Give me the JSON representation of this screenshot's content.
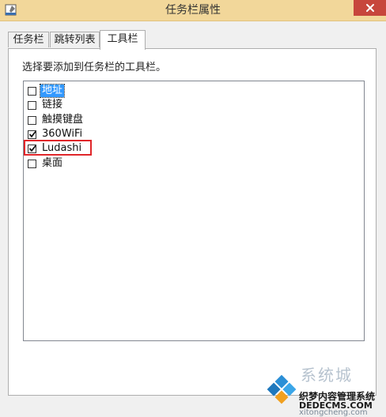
{
  "window": {
    "title": "任务栏属性"
  },
  "tabs": [
    {
      "label": "任务栏"
    },
    {
      "label": "跳转列表"
    },
    {
      "label": "工具栏"
    }
  ],
  "toolbars_tab": {
    "instruction": "选择要添加到任务栏的工具栏。",
    "items": [
      {
        "label": "地址",
        "checked": false,
        "selected": true
      },
      {
        "label": "链接",
        "checked": false,
        "selected": false
      },
      {
        "label": "触摸键盘",
        "checked": false,
        "selected": false
      },
      {
        "label": "360WiFi",
        "checked": true,
        "selected": false
      },
      {
        "label": "Ludashi",
        "checked": true,
        "selected": false,
        "highlighted": true
      },
      {
        "label": "桌面",
        "checked": false,
        "selected": false
      }
    ]
  },
  "watermark": {
    "line1": "系统城",
    "line2": "织梦内容管理系统",
    "line3": "DEDECMS.COM",
    "line4": "xitongcheng.com"
  },
  "colors": {
    "titlebar": "#f2d79a",
    "close_button": "#c7463c",
    "selection": "#3399ff",
    "annotation_box": "#e0262a"
  }
}
